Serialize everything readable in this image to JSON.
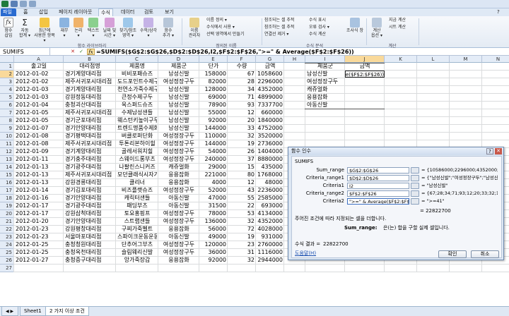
{
  "ribbon_tabs": [
    "파일",
    "홈",
    "삽입",
    "페이지 레이아웃",
    "수식",
    "데이터",
    "검토",
    "보기"
  ],
  "ribbon": {
    "big_buttons": [
      {
        "label": "함수\n삽입"
      },
      {
        "label": "자동\n합계 ▾"
      },
      {
        "label": "최근에\n사용한 항목 ▾"
      },
      {
        "label": "재무\n▾"
      },
      {
        "label": "논리\n▾"
      },
      {
        "label": "텍스트\n▾"
      },
      {
        "label": "날짜 및\n시간 ▾"
      },
      {
        "label": "찾기/참조\n영역 ▾"
      },
      {
        "label": "수학/삼각\n▾"
      },
      {
        "label": "함수\n추가 ▾"
      },
      {
        "label": "이름\n관리자"
      },
      {
        "label": "계산\n옵션 ▾"
      }
    ],
    "small_buttons": [
      "이름 정의 ▾",
      "수식에서 사용 ▾",
      "선택 영역에서 만들기",
      "참조되는 셀 추적",
      "참조하는 셀 추적",
      "연결선 제거 ▾",
      "수식 표시",
      "오류 검사 ▾",
      "수식 계산",
      "조사식 창",
      "지금 계산",
      "시트 계산"
    ],
    "groups": [
      "함수 라이브러리",
      "정의된 이름",
      "수식 분석",
      "계산"
    ]
  },
  "formula_bar": {
    "name_box": "SUMIFS",
    "cancel": "✕",
    "enter": "✓",
    "fx": "fx",
    "formula": "=SUMIFS($G$2:$G$26,$D$2:$D$26,I2,$F$2:$F$26,\">=\" & Average($F$2:$F$26))"
  },
  "columns": [
    "A",
    "B",
    "C",
    "D",
    "E",
    "F",
    "G",
    "H",
    "I",
    "J",
    "K",
    "L",
    "M",
    "N"
  ],
  "headers": [
    "출고일",
    "대리점명",
    "제품명",
    "제품군",
    "단가",
    "수량",
    "금액",
    "",
    "제품군",
    "금액"
  ],
  "rows": [
    [
      "2012-01-02",
      "경기계양대리점",
      "비비포패슈즈",
      "남성신발",
      "158000",
      "67",
      "10586000"
    ],
    [
      "2012-01-02",
      "제주서귀포시대리점",
      "도드포인트수제구두",
      "여성정장구두",
      "82000",
      "28",
      "2296000"
    ],
    [
      "2012-01-03",
      "경기계양대리점",
      "천연소가죽수제구두",
      "남성신발",
      "128000",
      "34",
      "4352000"
    ],
    [
      "2012-01-03",
      "강원정동대리점",
      "큰정수제구두",
      "남성신발",
      "69000",
      "71",
      "4899000"
    ],
    [
      "2012-01-04",
      "충청괴산대리점",
      "옥스퍼드슈즈",
      "남성신발",
      "78900",
      "93",
      "7337700"
    ],
    [
      "2012-01-05",
      "제주서귀포시대리점",
      "수제남성샌들",
      "남성신발",
      "55000",
      "12",
      "660000"
    ],
    [
      "2012-01-05",
      "경기군포대리점",
      "웨스턴키높이구두",
      "남성신발",
      "92000",
      "20",
      "1840000"
    ],
    [
      "2012-01-07",
      "경기안양대리점",
      "트렌드명품수제화",
      "남성신발",
      "144000",
      "33",
      "4752000"
    ],
    [
      "2012-01-08",
      "경기평택대리점",
      "버클로퍼단화",
      "여성정장구두",
      "110000",
      "32",
      "3520000"
    ],
    [
      "2012-01-08",
      "제주서귀포시대리점",
      "투톤리본하이힐",
      "여성정장구두",
      "144000",
      "19",
      "2736000"
    ],
    [
      "2012-01-09",
      "경기계양대리점",
      "골레서워치힐",
      "여성정장구두",
      "54000",
      "26",
      "1404000"
    ],
    [
      "2012-01-11",
      "경기충주대리점",
      "스웨이드롱부츠",
      "여성정장구두",
      "240000",
      "37",
      "8880000"
    ],
    [
      "2012-01-13",
      "경기광주대리점",
      "나팔린스니커즈",
      "캐쥬얼화",
      "29000",
      "15",
      "435000"
    ],
    [
      "2012-01-13",
      "제주서귀포시대리점",
      "모던클래식시자기방",
      "응용잡화",
      "221000",
      "80",
      "17680000"
    ],
    [
      "2012-01-13",
      "강원경릉대리점",
      "클리너",
      "응용잡화",
      "4000",
      "12",
      "48000"
    ],
    [
      "2012-01-14",
      "경기김포대리점",
      "비즈플랫슈즈",
      "여성정장구두",
      "52000",
      "43",
      "2236000"
    ],
    [
      "2012-01-16",
      "경기안양대리점",
      "캐릭터샌들",
      "아동신발",
      "47000",
      "55",
      "2585000"
    ],
    [
      "2012-01-17",
      "경기광주대리점",
      "패딩부츠",
      "아동신발",
      "31500",
      "22",
      "693000"
    ],
    [
      "2012-01-17",
      "강원삼척대리점",
      "토요홍핑프",
      "여성정장구두",
      "78000",
      "53",
      "4134000"
    ],
    [
      "2012-01-20",
      "경기안양대리점",
      "스트랩샌들",
      "여성정장구두",
      "136000",
      "32",
      "4352000"
    ],
    [
      "2012-01-23",
      "강원평창대리점",
      "구찌가죽벨트",
      "응용잡화",
      "56000",
      "72",
      "4028000"
    ],
    [
      "2012-01-23",
      "서울마포대리점",
      "스파이크운동운동화",
      "아동신발",
      "49000",
      "19",
      "931000"
    ],
    [
      "2012-01-25",
      "충청청원대리점",
      "단추어그부츠",
      "여성정장구두",
      "120000",
      "23",
      "2760000"
    ],
    [
      "2012-01-25",
      "충청옥천대리점",
      "슬림웨리신발",
      "여성정장구두",
      "36000",
      "31",
      "1116000"
    ],
    [
      "2012-01-27",
      "충청증구대리점",
      "앙가죽장갑",
      "응용잡화",
      "92000",
      "32",
      "2944000"
    ]
  ],
  "side_list": [
    "남성신발",
    "여성정장구두",
    "캐쥬얼화",
    "응용잡화",
    "아동신발"
  ],
  "editing_cell_text": "e($F$2:$F$26))",
  "dialog": {
    "title": "함수 인수",
    "function_name": "SUMIFS",
    "args": [
      {
        "label": "Sum_range",
        "value": "$G$2:$G$26",
        "result": "= {10586000;2296000;4352000;489..."
      },
      {
        "label": "Criteria_range1",
        "value": "$D$2:$D$26",
        "result": "= {\"남성신발\";\"여성정장구두\";\"남성신..."
      },
      {
        "label": "Criteria1",
        "value": "I2",
        "result": "= \"남성신발\""
      },
      {
        "label": "Criteria_range2",
        "value": "$F$2:$F$26",
        "result": "= {67;28;34;71;93;12;20;33;32;19;..."
      },
      {
        "label": "Criteria2",
        "value": "\">=\" & Average($F$2:$F$26)",
        "result": "= \">=41\""
      }
    ],
    "total_result": "= 22822700",
    "description": "주어진 조건에 따라 지정되는 셀을 더합니다.",
    "arg_label": "Sum_range:",
    "arg_description": "은(는) 합을 구할 실제 셀입니다.",
    "formula_result_label": "수식 결과 =",
    "formula_result_value": "22822700",
    "help_link": "도움말(H)",
    "ok": "확인",
    "cancel": "취소",
    "close": "✕",
    "help_icon": "?"
  },
  "sheet_tabs": [
    "Sheet1",
    "2 가지 이상 조건"
  ],
  "colors": {
    "accent": "#2a6bd0",
    "selected_header": "#f9d99a",
    "grid": "#dadcdd"
  }
}
